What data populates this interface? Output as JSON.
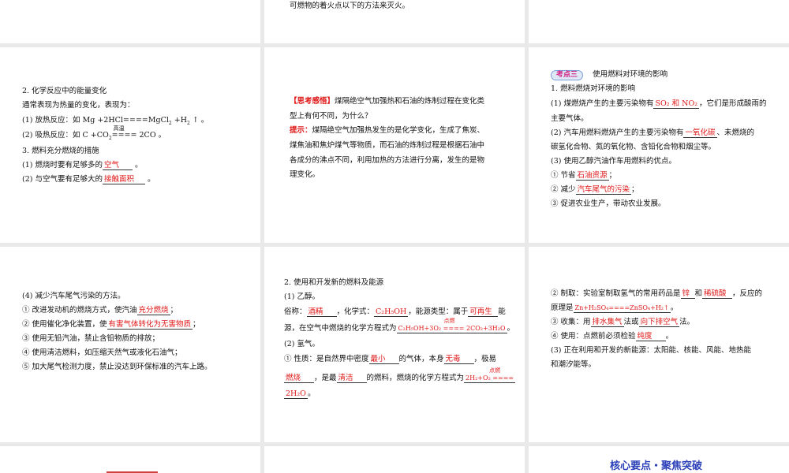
{
  "top_middle": {
    "line": "可燃物的着火点以下的方法来灭火。"
  },
  "s1": {
    "title": "2. 化学反应中的能量变化",
    "l1": "通常表现为热量的变化，表现为：",
    "l2a": "(1) 放热反应：如 Mg +2HCl====MgCl",
    "l2b": "2",
    "l2c": " +H",
    "l2d": "2",
    "l2e": " ↑ 。",
    "l3a": "(2) 吸热反应：如 C +CO",
    "l3b": "2",
    "l3cond": "高温",
    "l3c": "====",
    "l3d": " 2CO 。",
    "l4": "3. 燃料充分燃烧的措施",
    "l5a": "(1) 燃烧时要有足够多的",
    "l5ans": "空气",
    "l5b": " 。",
    "l6a": "(2) 与空气要有足够大的",
    "l6ans": "接触面积",
    "l6b": " 。"
  },
  "s2": {
    "tag": "【思考感悟】",
    "q1": "煤隔绝空气加强热和石油的炼制过程在变化类",
    "q2": "型上有何不同，为什么？",
    "hint": "提示：",
    "a1": "煤隔绝空气加强热发生的是化学变化，生成了焦炭、",
    "a2": "煤焦油和焦炉煤气等物质，而石油的炼制过程是根据石油中",
    "a3": "各成分的沸点不同，利用加热的方法进行分离，发生的是物",
    "a4": "理变化。"
  },
  "s3": {
    "badge": "考点三",
    "heading": "使用燃料对环境的影响",
    "l1": "1. 燃料燃烧对环境的影响",
    "l2a": "(1) 煤燃烧产生的主要污染物有",
    "l2ans": "SO₂ 和 NO₂",
    "l2b": "，它们是形成酸雨的",
    "l3": "主要气体。",
    "l4a": "(2) 汽车用燃料燃烧产生的主要污染物有",
    "l4ans": "一氧化碳",
    "l4b": "、未燃烧的",
    "l5": "碳氢化合物、氮的氧化物、含铅化合物和烟尘等。",
    "l6": "(3) 使用乙醇汽油作车用燃料的优点。",
    "l7a": "① 节省",
    "l7ans": "石油资源",
    "l7b": "；",
    "l8a": "② 减少",
    "l8ans": "汽车尾气的污染",
    "l8b": "；",
    "l9": "③ 促进农业生产，带动农业发展。"
  },
  "s4": {
    "l1": "(4) 减少汽车尾气污染的方法。",
    "l2a": "① 改进发动机的燃烧方式，使汽油",
    "l2ans": "充分燃烧",
    "l2b": "；",
    "l3a": "② 使用催化净化装置，使",
    "l3ans": "有害气体转化为无害物质",
    "l3b": "；",
    "l4": "③ 使用无铅汽油，禁止含铅物质的排放；",
    "l5": "④ 使用清洁燃料，如压缩天然气或液化石油气；",
    "l6": "⑤ 加大尾气检测力度，禁止没达到环保标准的汽车上路。"
  },
  "s5": {
    "l1": "2. 使用和开发新的燃料及能源",
    "l2": "(1) 乙醇。",
    "l3a": "俗称：",
    "l3ans1": "酒精",
    "l3b": "，化学式：",
    "l3ans2": "C₂H₅OH",
    "l3c": "，能源类型：属于",
    "l3ans3": "可再生",
    "l3d": "能",
    "l4a": "源，在空气中燃烧的化学方程式为",
    "l4cond": "点燃",
    "l4ans": "C₂H₅OH+3O₂ ==== 2CO₂+3H₂O",
    "l4b": "。",
    "l5": "(2) 氢气。",
    "l6a": "① 性质：是自然界中密度",
    "l6ans1": "最小",
    "l6b": "的气体，本身",
    "l6ans2": "无毒",
    "l6c": "，极易",
    "l7ans1": "燃烧",
    "l7a": "，是最",
    "l7ans2": "清洁",
    "l7b": "的燃料，燃烧的化学方程式为",
    "l7cond": "点燃",
    "l7ans3": "2H₂+O₂ ====",
    "l8ans": "2H₂O",
    "l8b": "。"
  },
  "s6": {
    "l1a": "② 制取：实验室制取氢气的常用药品是",
    "l1ans1": "锌",
    "l1b": "和",
    "l1ans2": "稀硫酸",
    "l1c": "，反应的",
    "l2a": "原理是",
    "l2ans": "Zn+H₂SO₄====ZnSO₄+H₂↑",
    "l2b": "。",
    "l3a": "③ 收集：用",
    "l3ans1": "排水集气",
    "l3b": "法或",
    "l3ans2": "向下排空气",
    "l3c": "法。",
    "l4a": "④ 使用：点燃前必须检验",
    "l4ans": "纯度",
    "l4b": "。",
    "l5": "(3) 正在利用和开发的新能源：太阳能、核能、风能、地热能",
    "l6": "和潮汐能等。"
  },
  "bottom_right": {
    "banner": "核心要点・聚焦突破"
  }
}
